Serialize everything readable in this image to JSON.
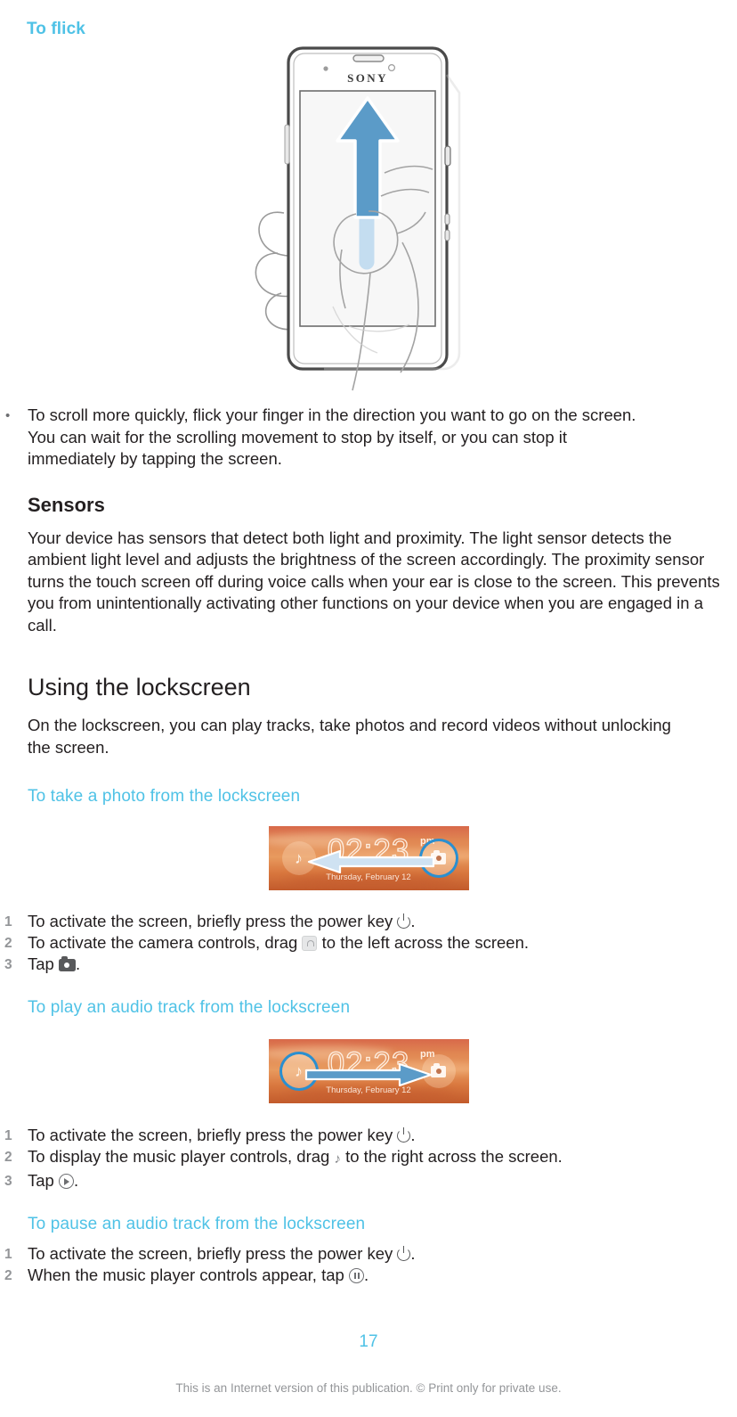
{
  "headings": {
    "to_flick": "To flick",
    "sensors": "Sensors",
    "using_lockscreen": "Using the lockscreen",
    "take_photo": "To take a photo from the lockscreen",
    "play_audio": "To play an audio track from the lockscreen",
    "pause_audio": "To pause an audio track from the lockscreen"
  },
  "flick_bullet": "To scroll more quickly, flick your finger in the direction you want to go on the screen. You can wait for the scrolling movement to stop by itself, or you can stop it immediately by tapping the screen.",
  "sensors_text": "Your device has sensors that detect both light and proximity. The light sensor detects the ambient light level and adjusts the brightness of the screen accordingly. The proximity sensor turns the touch screen off during voice calls when your ear is close to the screen. This prevents you from unintentionally activating other functions on your device when you are engaged in a call.",
  "lockscreen_text": "On the lockscreen, you can play tracks, take photos and record videos without unlocking the screen.",
  "phone_figure": {
    "brand": "SONY",
    "gesture": "flick-up-arrow",
    "alt": "Hand flicking upward on a Sony smartphone screen"
  },
  "lockscreen_photo": {
    "time": "02:23",
    "ampm": "pm",
    "date": "Thursday, February 12",
    "left_icon": "music-note-icon",
    "right_icon": "camera-icon",
    "arrow_direction": "left",
    "highlighted_badge": "right"
  },
  "lockscreen_audio": {
    "time": "02:23",
    "ampm": "pm",
    "date": "Thursday, February 12",
    "left_icon": "music-note-icon",
    "right_icon": "camera-icon",
    "arrow_direction": "right",
    "highlighted_badge": "left"
  },
  "steps_photo": [
    {
      "num": "1",
      "before": "To activate the screen, briefly press the power key ",
      "icon": "power-icon",
      "after": "."
    },
    {
      "num": "2",
      "before": "To activate the camera controls, drag ",
      "icon": "lock-icon",
      "after": " to the left across the screen."
    },
    {
      "num": "3",
      "before": "Tap ",
      "icon": "camera-icon",
      "after": "."
    }
  ],
  "steps_play": [
    {
      "num": "1",
      "before": "To activate the screen, briefly press the power key ",
      "icon": "power-icon",
      "after": "."
    },
    {
      "num": "2",
      "before": "To display the music player controls, drag ",
      "icon": "music-note-icon",
      "after": " to the right across the screen."
    },
    {
      "num": "3",
      "before": "Tap ",
      "icon": "play-icon",
      "after": "."
    }
  ],
  "steps_pause": [
    {
      "num": "1",
      "before": "To activate the screen, briefly press the power key ",
      "icon": "power-icon",
      "after": "."
    },
    {
      "num": "2",
      "before": "When the music player controls appear, tap ",
      "icon": "pause-icon",
      "after": "."
    }
  ],
  "footer": {
    "page_number": "17",
    "note": "This is an Internet version of this publication. © Print only for private use."
  },
  "colors": {
    "accent_blue": "#4FC2E6",
    "body_text": "#231f20",
    "muted_gray": "#939598"
  }
}
